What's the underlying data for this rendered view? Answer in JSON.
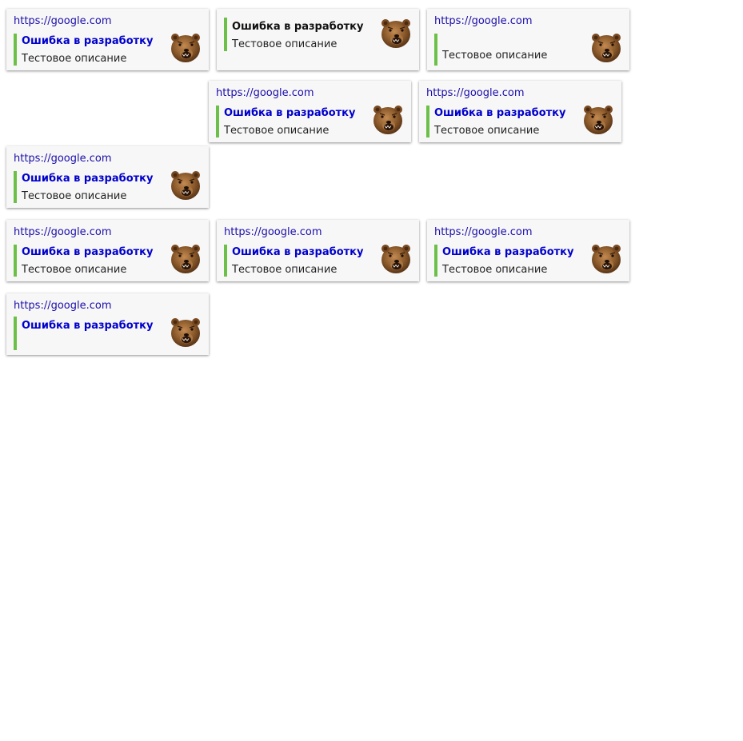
{
  "cards": [
    {
      "url": "https://google.com",
      "title": "Ошибка в разработку",
      "description": "Тестовое описание"
    },
    {
      "url": "",
      "title": "Ошибка в разработку",
      "description": "Тестовое описание"
    },
    {
      "url": "https://google.com",
      "title": "",
      "description": "Тестовое описание"
    },
    {
      "url": "https://google.com",
      "title": "Ошибка в разработку",
      "description": "Тестовое описание"
    },
    {
      "url": "https://google.com",
      "title": "Ошибка в разработку",
      "description": "Тестовое описание"
    },
    {
      "url": "https://google.com",
      "title": "Ошибка в разработку",
      "description": "Тестовое описание"
    },
    {
      "url": "https://google.com",
      "title": "Ошибка в разработку",
      "description": "Тестовое описание"
    },
    {
      "url": "https://google.com",
      "title": "Ошибка в разработку",
      "description": "Тестовое описание"
    },
    {
      "url": "https://google.com",
      "title": "Ошибка в разработку",
      "description": "Тестовое описание"
    },
    {
      "url": "https://google.com",
      "title": "Ошибка в разработку",
      "description": ""
    }
  ],
  "colors": {
    "link": "#1a0dab",
    "title": "#0000cc",
    "accent_bar": "#6cc04a",
    "card_background": "#f7f7f7"
  },
  "icons": {
    "thumbnail": "bear-icon"
  }
}
